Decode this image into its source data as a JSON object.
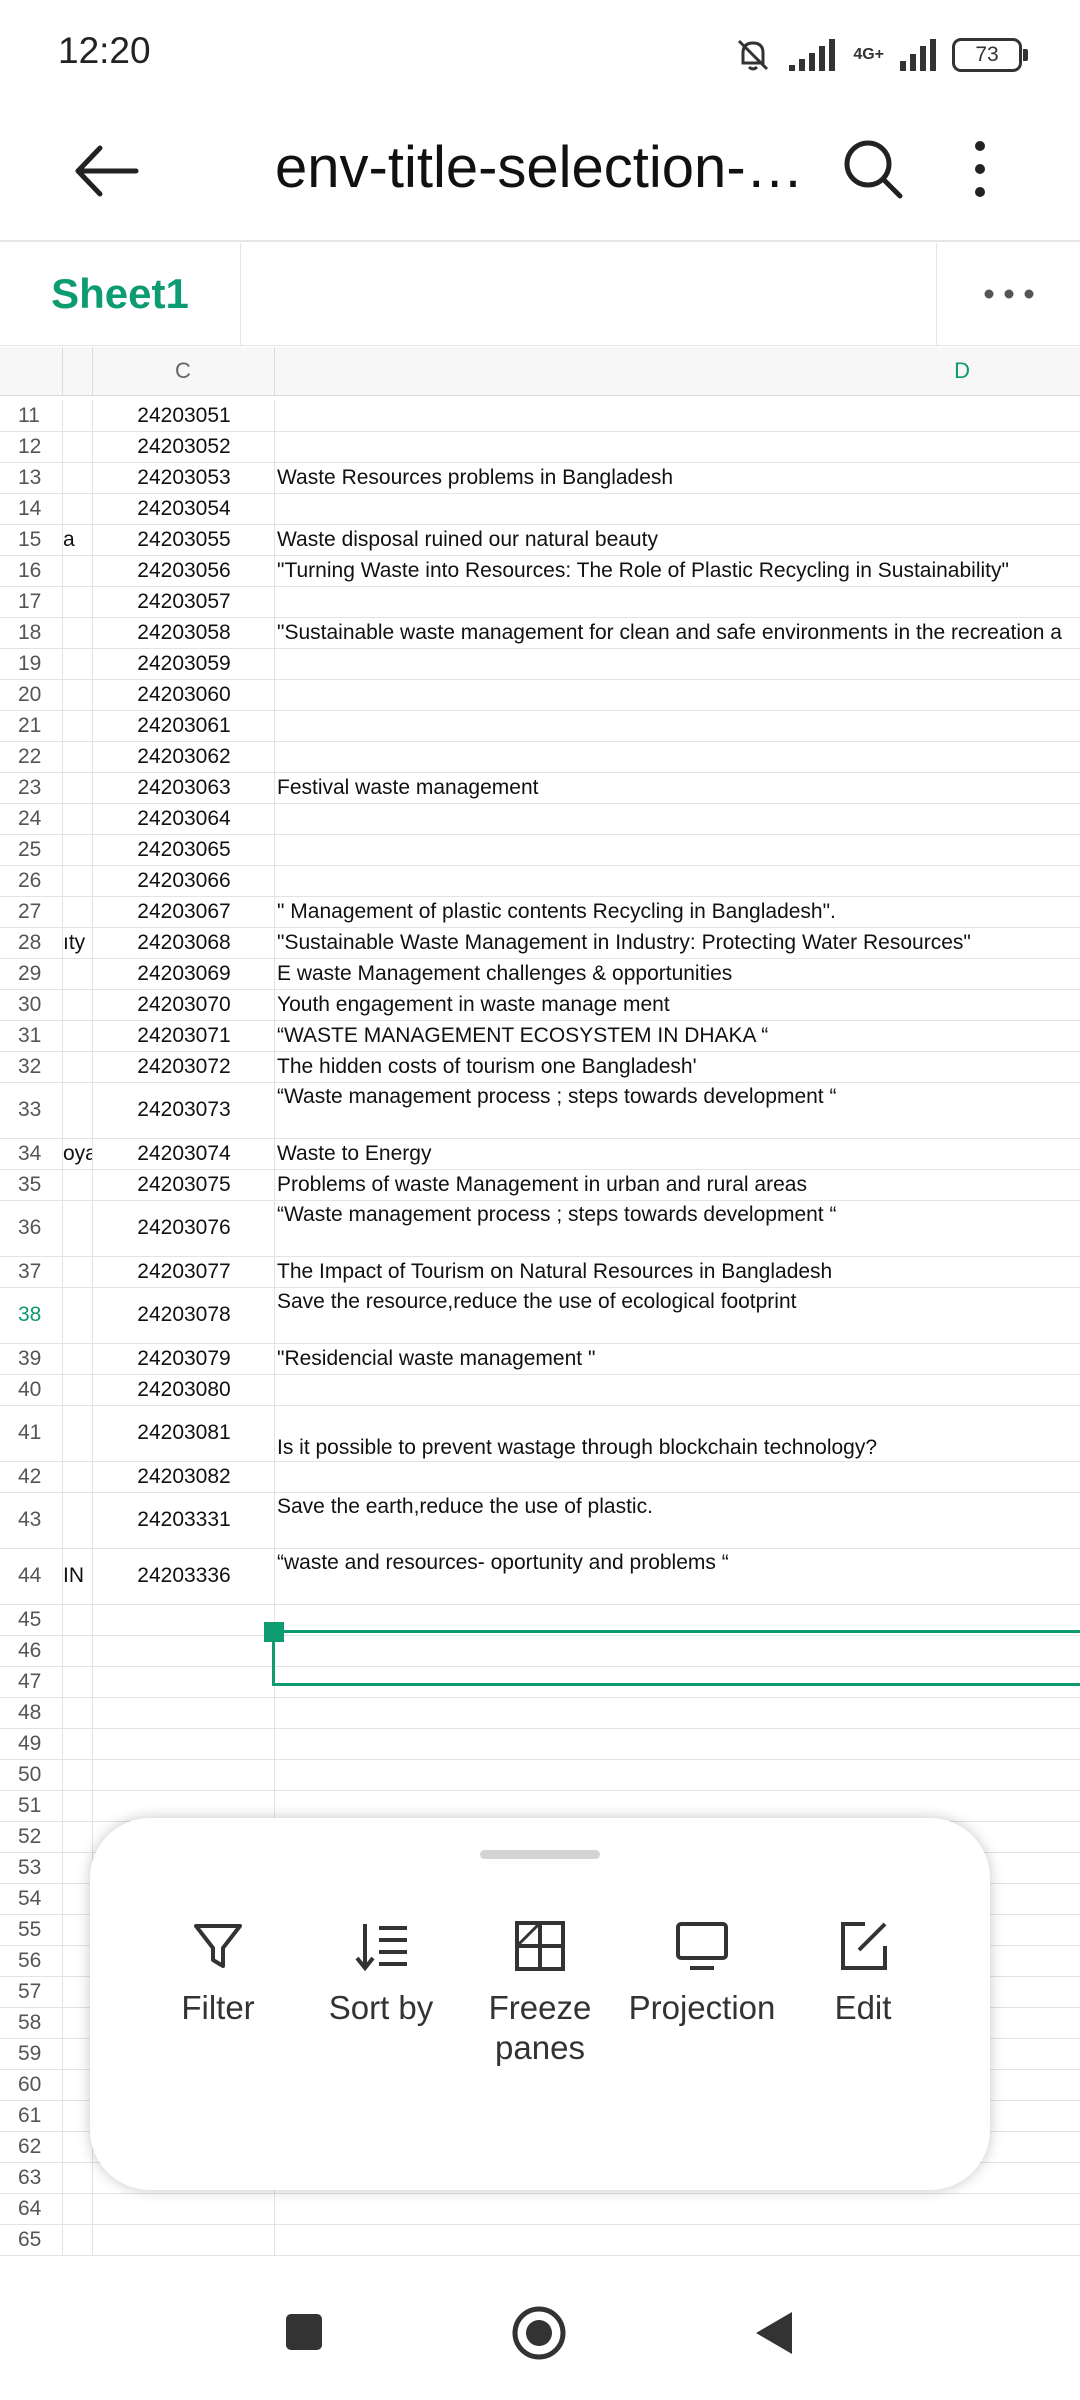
{
  "status_bar": {
    "time": "12:20",
    "network": "4G+",
    "battery": "73"
  },
  "app_bar": {
    "title": "env-title-selection-2..."
  },
  "sheet": {
    "tab": "Sheet1"
  },
  "columns": [
    "C",
    "D"
  ],
  "rows": [
    {
      "n": "11",
      "b": "",
      "c": "24203051",
      "d": ""
    },
    {
      "n": "12",
      "b": "",
      "c": "24203052",
      "d": ""
    },
    {
      "n": "13",
      "b": "",
      "c": "24203053",
      "d": "Waste Resources problems in Bangladesh"
    },
    {
      "n": "14",
      "b": "",
      "c": "24203054",
      "d": ""
    },
    {
      "n": "15",
      "b": "a",
      "c": "24203055",
      "d": "Waste disposal ruined our natural beauty"
    },
    {
      "n": "16",
      "b": "",
      "c": "24203056",
      "d": "\"Turning Waste into Resources: The Role of Plastic Recycling in Sustainability\""
    },
    {
      "n": "17",
      "b": "",
      "c": "24203057",
      "d": ""
    },
    {
      "n": "18",
      "b": "",
      "c": "24203058",
      "d": "\"Sustainable waste management for clean and safe environments in the recreation a"
    },
    {
      "n": "19",
      "b": "",
      "c": "24203059",
      "d": ""
    },
    {
      "n": "20",
      "b": "",
      "c": "24203060",
      "d": ""
    },
    {
      "n": "21",
      "b": "",
      "c": "24203061",
      "d": ""
    },
    {
      "n": "22",
      "b": "",
      "c": "24203062",
      "d": ""
    },
    {
      "n": "23",
      "b": "",
      "c": "24203063",
      "d": "Festival waste management"
    },
    {
      "n": "24",
      "b": "",
      "c": "24203064",
      "d": ""
    },
    {
      "n": "25",
      "b": "",
      "c": "24203065",
      "d": ""
    },
    {
      "n": "26",
      "b": "",
      "c": "24203066",
      "d": ""
    },
    {
      "n": "27",
      "b": "",
      "c": "24203067",
      "d": "\" Management of plastic contents Recycling in Bangladesh\"."
    },
    {
      "n": "28",
      "b": "ıty",
      "c": "24203068",
      "d": "\"Sustainable Waste Management in Industry: Protecting Water Resources\""
    },
    {
      "n": "29",
      "b": "",
      "c": "24203069",
      "d": "E waste Management challenges & opportunities"
    },
    {
      "n": "30",
      "b": "",
      "c": "24203070",
      "d": "Youth engagement in waste manage ment"
    },
    {
      "n": "31",
      "b": "",
      "c": "24203071",
      "d": "“WASTE MANAGEMENT ECOSYSTEM IN DHAKA “"
    },
    {
      "n": "32",
      "b": "",
      "c": "24203072",
      "d": "The hidden costs of tourism one Bangladesh'"
    },
    {
      "n": "33",
      "b": "",
      "c": "24203073",
      "d": "“Waste management process ; steps towards development “"
    },
    {
      "n": "34",
      "b": "oya",
      "c": "24203074",
      "d": "Waste to Energy"
    },
    {
      "n": "35",
      "b": "",
      "c": "24203075",
      "d": "Problems of waste Management in urban and rural areas"
    },
    {
      "n": "36",
      "b": "",
      "c": "24203076",
      "d": "“Waste management process ; steps towards development “"
    },
    {
      "n": "37",
      "b": "",
      "c": "24203077",
      "d": "The Impact of Tourism on Natural Resources in Bangladesh"
    },
    {
      "n": "38",
      "b": "",
      "c": "24203078",
      "d": "Save the resource,reduce the use of ecological footprint"
    },
    {
      "n": "39",
      "b": "",
      "c": "24203079",
      "d": "\"Residencial waste management \""
    },
    {
      "n": "40",
      "b": "",
      "c": "24203080",
      "d": ""
    },
    {
      "n": "41",
      "b": "",
      "c": "24203081",
      "d": "Is it possible to prevent wastage through blockchain technology?"
    },
    {
      "n": "42",
      "b": "",
      "c": "24203082",
      "d": ""
    },
    {
      "n": "43",
      "b": "",
      "c": "24203331",
      "d": "Save the earth,reduce the use of plastic."
    },
    {
      "n": "44",
      "b": "IN",
      "c": "24203336",
      "d": "“waste and resources- oportunity and problems  “"
    },
    {
      "n": "45",
      "b": "",
      "c": "",
      "d": ""
    },
    {
      "n": "46",
      "b": "",
      "c": "",
      "d": ""
    },
    {
      "n": "47",
      "b": "",
      "c": "",
      "d": ""
    },
    {
      "n": "48",
      "b": "",
      "c": "",
      "d": ""
    },
    {
      "n": "49",
      "b": "",
      "c": "",
      "d": ""
    },
    {
      "n": "50",
      "b": "",
      "c": "",
      "d": ""
    },
    {
      "n": "51",
      "b": "",
      "c": "",
      "d": ""
    },
    {
      "n": "52",
      "b": "",
      "c": "",
      "d": ""
    },
    {
      "n": "53",
      "b": "",
      "c": "",
      "d": ""
    },
    {
      "n": "54",
      "b": "",
      "c": "",
      "d": ""
    },
    {
      "n": "55",
      "b": "",
      "c": "",
      "d": ""
    },
    {
      "n": "56",
      "b": "",
      "c": "",
      "d": ""
    },
    {
      "n": "57",
      "b": "",
      "c": "",
      "d": ""
    },
    {
      "n": "58",
      "b": "",
      "c": "",
      "d": ""
    },
    {
      "n": "59",
      "b": "",
      "c": "",
      "d": ""
    },
    {
      "n": "60",
      "b": "",
      "c": "",
      "d": ""
    },
    {
      "n": "61",
      "b": "",
      "c": "",
      "d": ""
    },
    {
      "n": "62",
      "b": "",
      "c": "",
      "d": ""
    },
    {
      "n": "63",
      "b": "",
      "c": "",
      "d": ""
    },
    {
      "n": "64",
      "b": "",
      "c": "",
      "d": ""
    },
    {
      "n": "65",
      "b": "",
      "c": "",
      "d": ""
    }
  ],
  "selected_row": "38",
  "toolbar": {
    "filter": "Filter",
    "sort_by": "Sort by",
    "freeze_panes": "Freeze panes",
    "projection": "Projection",
    "edit": "Edit"
  },
  "colors": {
    "accent": "#0d9b72"
  }
}
